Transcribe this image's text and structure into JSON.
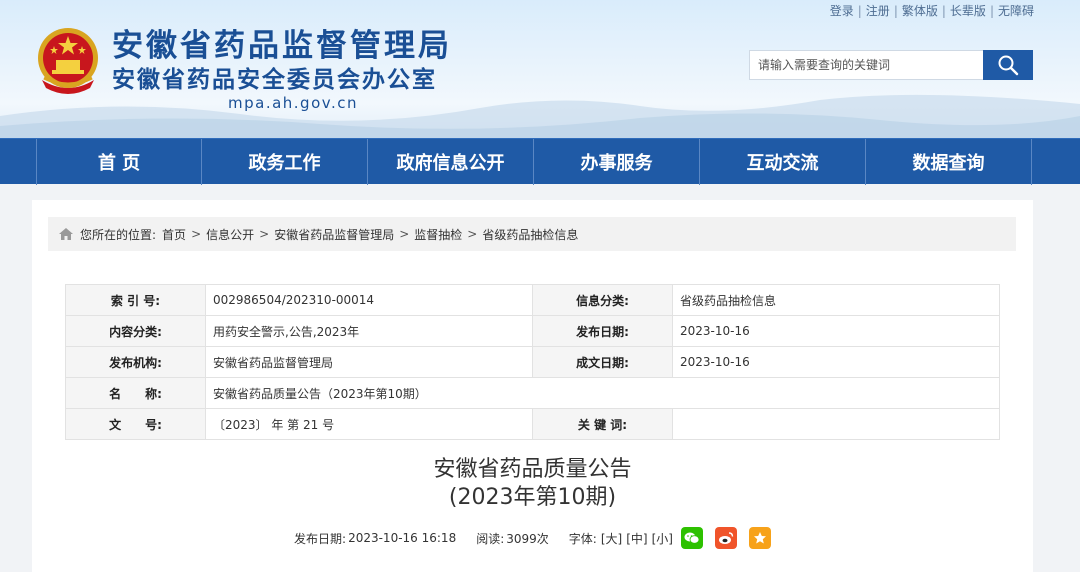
{
  "header": {
    "title_line1": "安徽省药品监督管理局",
    "title_line2": "安徽省药品安全委员会办公室",
    "domain": "mpa.ah.gov.cn",
    "top_links": [
      "登录",
      "注册",
      "繁体版",
      "长辈版",
      "无障碍"
    ],
    "search_placeholder": "请输入需要查询的关键词",
    "emblem_icon": "national-emblem-icon",
    "search_icon": "search-icon"
  },
  "nav": {
    "items": [
      "首 页",
      "政务工作",
      "政府信息公开",
      "办事服务",
      "互动交流",
      "数据查询"
    ]
  },
  "breadcrumb": {
    "prefix": "您所在的位置:",
    "items": [
      "首页",
      "信息公开",
      "安徽省药品监督管理局",
      "监督抽检",
      "省级药品抽检信息"
    ]
  },
  "meta": {
    "index_label": "索 引 号:",
    "index_value": "002986504/202310-00014",
    "category_label": "信息分类:",
    "category_value": "省级药品抽检信息",
    "content_label": "内容分类:",
    "content_value": "用药安全警示,公告,2023年",
    "publish_label": "发布日期:",
    "publish_value": "2023-10-16",
    "org_label": "发布机构:",
    "org_value": "安徽省药品监督管理局",
    "written_label": "成文日期:",
    "written_value": "2023-10-16",
    "name_label": "名　　称:",
    "name_value": "安徽省药品质量公告（2023年第10期）",
    "doc_label": "文　　号:",
    "doc_value": "〔2023〕 年 第 21 号",
    "keywords_label": "关 键 词:",
    "keywords_value": ""
  },
  "article": {
    "title_line1": "安徽省药品质量公告",
    "title_line2": "(2023年第10期)",
    "date_label": "发布日期:",
    "date_value": "2023-10-16 16:18",
    "views_label": "阅读:",
    "views_value": "3099次",
    "font_label": "字体:",
    "font_large": "[大]",
    "font_medium": "[中]",
    "font_small": "[小]"
  },
  "colors": {
    "brand_blue": "#1f5aa6",
    "title_blue": "#1a4f95",
    "wechat_green": "#2dc100",
    "weibo_orange": "#f0542a",
    "favorite_orange": "#f7a21a"
  }
}
